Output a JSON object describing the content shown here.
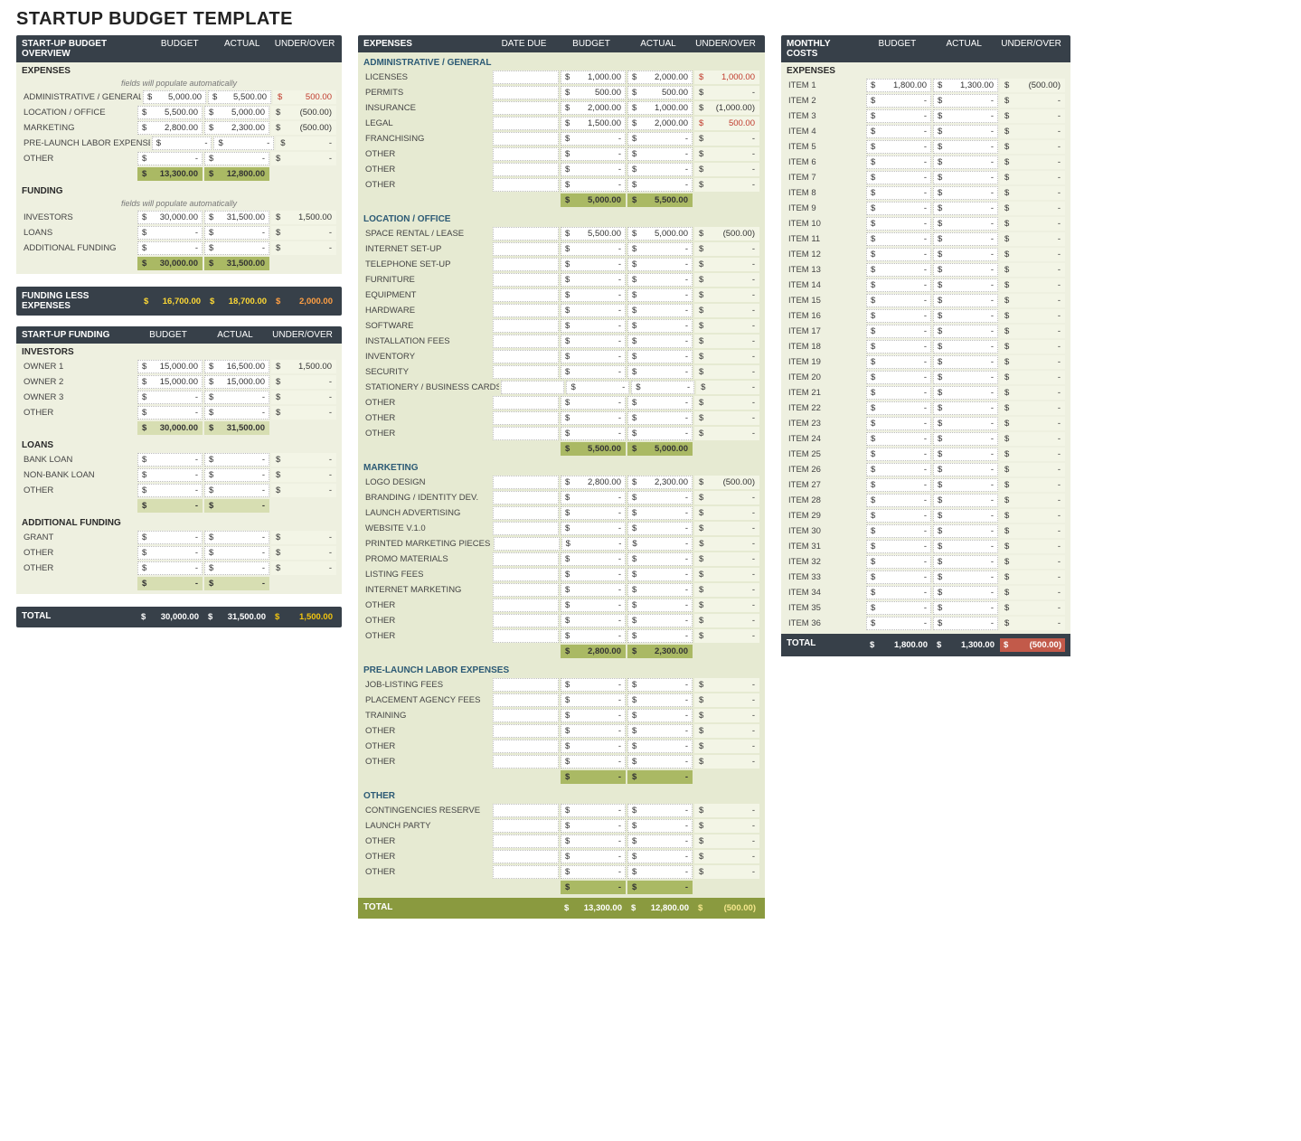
{
  "title": "STARTUP BUDGET TEMPLATE",
  "hdr": {
    "budget": "BUDGET",
    "actual": "ACTUAL",
    "uo": "UNDER/OVER",
    "date_due": "DATE DUE"
  },
  "auto_note": "fields will populate automatically",
  "panel1": {
    "title": "START-UP BUDGET OVERVIEW",
    "expenses_title": "EXPENSES",
    "expenses": [
      {
        "l": "ADMINISTRATIVE / GENERAL",
        "b": "5,000.00",
        "a": "5,500.00",
        "u": "500.00",
        "red": true
      },
      {
        "l": "LOCATION / OFFICE",
        "b": "5,500.00",
        "a": "5,000.00",
        "u": "(500.00)"
      },
      {
        "l": "MARKETING",
        "b": "2,800.00",
        "a": "2,300.00",
        "u": "(500.00)"
      },
      {
        "l": "PRE-LAUNCH LABOR EXPENSES",
        "b": "-",
        "a": "-",
        "u": "-"
      },
      {
        "l": "OTHER",
        "b": "-",
        "a": "-",
        "u": "-"
      }
    ],
    "expenses_sub": {
      "b": "13,300.00",
      "a": "12,800.00"
    },
    "funding_title": "FUNDING",
    "funding": [
      {
        "l": "INVESTORS",
        "b": "30,000.00",
        "a": "31,500.00",
        "u": "1,500.00"
      },
      {
        "l": "LOANS",
        "b": "-",
        "a": "-",
        "u": "-"
      },
      {
        "l": "ADDITIONAL FUNDING",
        "b": "-",
        "a": "-",
        "u": "-"
      }
    ],
    "funding_sub": {
      "b": "30,000.00",
      "a": "31,500.00"
    },
    "fle": {
      "l": "FUNDING LESS EXPENSES",
      "b": "16,700.00",
      "a": "18,700.00",
      "u": "2,000.00"
    }
  },
  "panel2": {
    "title": "START-UP FUNDING",
    "investors_title": "INVESTORS",
    "investors": [
      {
        "l": "OWNER 1",
        "b": "15,000.00",
        "a": "16,500.00",
        "u": "1,500.00"
      },
      {
        "l": "OWNER 2",
        "b": "15,000.00",
        "a": "15,000.00",
        "u": "-"
      },
      {
        "l": "OWNER 3",
        "b": "-",
        "a": "-",
        "u": "-"
      },
      {
        "l": "OTHER",
        "b": "-",
        "a": "-",
        "u": "-"
      }
    ],
    "investors_sub": {
      "b": "30,000.00",
      "a": "31,500.00"
    },
    "loans_title": "LOANS",
    "loans": [
      {
        "l": "BANK LOAN",
        "b": "-",
        "a": "-",
        "u": "-"
      },
      {
        "l": "NON-BANK LOAN",
        "b": "-",
        "a": "-",
        "u": "-"
      },
      {
        "l": "OTHER",
        "b": "-",
        "a": "-",
        "u": "-"
      }
    ],
    "loans_sub": {
      "b": "-",
      "a": "-"
    },
    "addl_title": "ADDITIONAL FUNDING",
    "addl": [
      {
        "l": "GRANT",
        "b": "-",
        "a": "-",
        "u": "-"
      },
      {
        "l": "OTHER",
        "b": "-",
        "a": "-",
        "u": "-"
      },
      {
        "l": "OTHER",
        "b": "-",
        "a": "-",
        "u": "-"
      }
    ],
    "addl_sub": {
      "b": "-",
      "a": "-"
    },
    "total": {
      "l": "TOTAL",
      "b": "30,000.00",
      "a": "31,500.00",
      "u": "1,500.00"
    }
  },
  "expenses_panel": {
    "title": "EXPENSES",
    "sections": [
      {
        "title": "ADMINISTRATIVE / GENERAL",
        "rows": [
          {
            "l": "LICENSES",
            "b": "1,000.00",
            "a": "2,000.00",
            "u": "1,000.00",
            "red": true
          },
          {
            "l": "PERMITS",
            "b": "500.00",
            "a": "500.00",
            "u": "-"
          },
          {
            "l": "INSURANCE",
            "b": "2,000.00",
            "a": "1,000.00",
            "u": "(1,000.00)"
          },
          {
            "l": "LEGAL",
            "b": "1,500.00",
            "a": "2,000.00",
            "u": "500.00",
            "red": true
          },
          {
            "l": "FRANCHISING",
            "b": "-",
            "a": "-",
            "u": "-"
          },
          {
            "l": "OTHER",
            "b": "-",
            "a": "-",
            "u": "-"
          },
          {
            "l": "OTHER",
            "b": "-",
            "a": "-",
            "u": "-"
          },
          {
            "l": "OTHER",
            "b": "-",
            "a": "-",
            "u": "-"
          }
        ],
        "sub": {
          "b": "5,000.00",
          "a": "5,500.00"
        }
      },
      {
        "title": "LOCATION / OFFICE",
        "rows": [
          {
            "l": "SPACE RENTAL / LEASE",
            "b": "5,500.00",
            "a": "5,000.00",
            "u": "(500.00)"
          },
          {
            "l": "INTERNET SET-UP",
            "b": "-",
            "a": "-",
            "u": "-"
          },
          {
            "l": "TELEPHONE SET-UP",
            "b": "-",
            "a": "-",
            "u": "-"
          },
          {
            "l": "FURNITURE",
            "b": "-",
            "a": "-",
            "u": "-"
          },
          {
            "l": "EQUIPMENT",
            "b": "-",
            "a": "-",
            "u": "-"
          },
          {
            "l": "HARDWARE",
            "b": "-",
            "a": "-",
            "u": "-"
          },
          {
            "l": "SOFTWARE",
            "b": "-",
            "a": "-",
            "u": "-"
          },
          {
            "l": "INSTALLATION FEES",
            "b": "-",
            "a": "-",
            "u": "-"
          },
          {
            "l": "INVENTORY",
            "b": "-",
            "a": "-",
            "u": "-"
          },
          {
            "l": "SECURITY",
            "b": "-",
            "a": "-",
            "u": "-"
          },
          {
            "l": "STATIONERY / BUSINESS CARDS",
            "b": "-",
            "a": "-",
            "u": "-"
          },
          {
            "l": "OTHER",
            "b": "-",
            "a": "-",
            "u": "-"
          },
          {
            "l": "OTHER",
            "b": "-",
            "a": "-",
            "u": "-"
          },
          {
            "l": "OTHER",
            "b": "-",
            "a": "-",
            "u": "-"
          }
        ],
        "sub": {
          "b": "5,500.00",
          "a": "5,000.00"
        }
      },
      {
        "title": "MARKETING",
        "rows": [
          {
            "l": "LOGO DESIGN",
            "b": "2,800.00",
            "a": "2,300.00",
            "u": "(500.00)"
          },
          {
            "l": "BRANDING / IDENTITY DEV.",
            "b": "-",
            "a": "-",
            "u": "-"
          },
          {
            "l": "LAUNCH ADVERTISING",
            "b": "-",
            "a": "-",
            "u": "-"
          },
          {
            "l": "WEBSITE v.1.0",
            "b": "-",
            "a": "-",
            "u": "-"
          },
          {
            "l": "PRINTED MARKETING PIECES",
            "b": "-",
            "a": "-",
            "u": "-"
          },
          {
            "l": "PROMO MATERIALS",
            "b": "-",
            "a": "-",
            "u": "-"
          },
          {
            "l": "LISTING FEES",
            "b": "-",
            "a": "-",
            "u": "-"
          },
          {
            "l": "INTERNET MARKETING",
            "b": "-",
            "a": "-",
            "u": "-"
          },
          {
            "l": "OTHER",
            "b": "-",
            "a": "-",
            "u": "-"
          },
          {
            "l": "OTHER",
            "b": "-",
            "a": "-",
            "u": "-"
          },
          {
            "l": "OTHER",
            "b": "-",
            "a": "-",
            "u": "-"
          }
        ],
        "sub": {
          "b": "2,800.00",
          "a": "2,300.00"
        }
      },
      {
        "title": "PRE-LAUNCH LABOR EXPENSES",
        "rows": [
          {
            "l": "JOB-LISTING FEES",
            "b": "-",
            "a": "-",
            "u": "-"
          },
          {
            "l": "PLACEMENT AGENCY FEES",
            "b": "-",
            "a": "-",
            "u": "-"
          },
          {
            "l": "TRAINING",
            "b": "-",
            "a": "-",
            "u": "-"
          },
          {
            "l": "OTHER",
            "b": "-",
            "a": "-",
            "u": "-"
          },
          {
            "l": "OTHER",
            "b": "-",
            "a": "-",
            "u": "-"
          },
          {
            "l": "OTHER",
            "b": "-",
            "a": "-",
            "u": "-"
          }
        ],
        "sub": {
          "b": "-",
          "a": "-"
        }
      },
      {
        "title": "OTHER",
        "rows": [
          {
            "l": "CONTINGENCIES RESERVE",
            "b": "-",
            "a": "-",
            "u": "-"
          },
          {
            "l": "LAUNCH PARTY",
            "b": "-",
            "a": "-",
            "u": "-"
          },
          {
            "l": "OTHER",
            "b": "-",
            "a": "-",
            "u": "-"
          },
          {
            "l": "OTHER",
            "b": "-",
            "a": "-",
            "u": "-"
          },
          {
            "l": "OTHER",
            "b": "-",
            "a": "-",
            "u": "-"
          }
        ],
        "sub": {
          "b": "-",
          "a": "-"
        }
      }
    ],
    "total": {
      "l": "TOTAL",
      "b": "13,300.00",
      "a": "12,800.00",
      "u": "(500.00)"
    }
  },
  "monthly": {
    "title": "MONTHLY COSTS",
    "expenses_title": "EXPENSES",
    "first": {
      "l": "ITEM 1",
      "b": "1,800.00",
      "a": "1,300.00",
      "u": "(500.00)"
    },
    "item_prefix": "ITEM ",
    "count": 36,
    "total": {
      "l": "TOTAL",
      "b": "1,800.00",
      "a": "1,300.00",
      "u": "(500.00)"
    }
  },
  "cur": "$"
}
